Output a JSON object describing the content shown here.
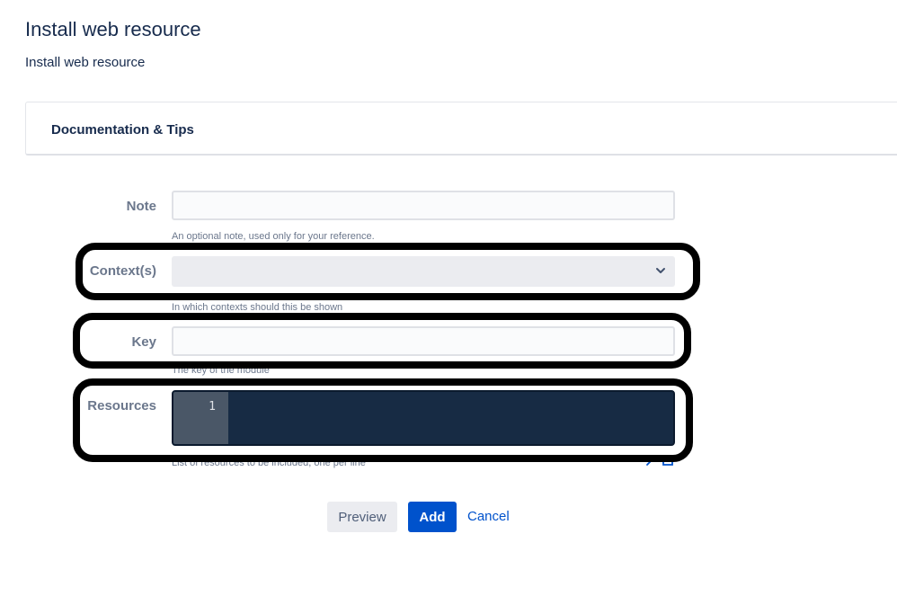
{
  "page": {
    "title": "Install web resource",
    "subtitle": "Install web resource"
  },
  "documentation": {
    "label": "Documentation & Tips"
  },
  "form": {
    "note": {
      "label": "Note",
      "value": "",
      "help": "An optional note, used only for your reference."
    },
    "contexts": {
      "label": "Context(s)",
      "selected": "",
      "help": "In which contexts should this be shown",
      "icon": "chevron-down-icon"
    },
    "key": {
      "label": "Key",
      "value": "",
      "help": "The key of the module"
    },
    "resources": {
      "label": "Resources",
      "line_number": "1",
      "help": "List of resources to be included, one per line",
      "icon": "expand-icon"
    }
  },
  "actions": {
    "preview_label": "Preview",
    "add_label": "Add",
    "cancel_label": "Cancel"
  },
  "colors": {
    "primary": "#0052cc",
    "editor_background": "#172b44",
    "annotation_outline": "#000000"
  }
}
